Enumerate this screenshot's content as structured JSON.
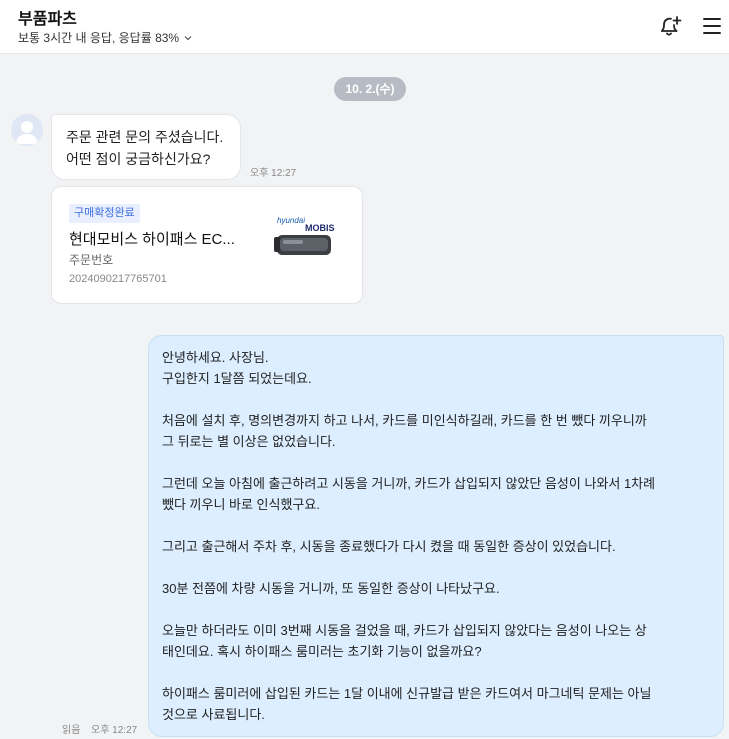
{
  "header": {
    "shop_name": "부품파츠",
    "response_info": "보통 3시간 내 응답, 응답률 83%"
  },
  "chat": {
    "date": "10. 2.(수)",
    "incoming": {
      "line1": "주문 관련 문의 주셨습니다.",
      "line2": "어떤 점이 궁금하신가요?",
      "time": "오후 12:27"
    },
    "order": {
      "status": "구매확정완료",
      "product": "현대모비스 하이패스 EC...",
      "number_label": "주문번호",
      "number": "2024090217765701",
      "thumb_brand1": "hyundai",
      "thumb_brand2": "MOBIS"
    },
    "outgoing": {
      "l1": "안녕하세요. 사장님.",
      "l2": "구입한지 1달쯤 되었는데요.",
      "l3": "처음에 설치 후, 명의변경까지 하고 나서, 카드를 미인식하길래, 카드를 한 번 뺐다 끼우니까",
      "l4": "그 뒤로는 별 이상은 없었습니다.",
      "l5": "그런데 오늘 아침에 출근하려고 시동을 거니까, 카드가 삽입되지 않았단 음성이 나와서 1차례",
      "l6": "뺐다 끼우니 바로 인식했구요.",
      "l7": "그리고 출근해서 주차 후, 시동을 종료했다가 다시 켰을 때 동일한 증상이 있었습니다.",
      "l8": "30분 전쯤에 차량 시동을 거니까, 또 동일한 증상이 나타났구요.",
      "l9": "오늘만 하더라도 이미 3번째 시동을 걸었을 때, 카드가 삽입되지 않았다는 음성이 나오는 상",
      "l10": "태인데요. 혹시 하이패스 룸미러는 초기화 기능이 없을까요?",
      "l11": "하이패스 룸미러에 삽입된 카드는 1달 이내에 신규발급 받은 카드여서 마그네틱 문제는 아닐",
      "l12": "것으로 사료됩니다.",
      "read": "읽음",
      "time": "오후 12:27"
    }
  },
  "icons": {
    "chevron": "chevron-down-icon",
    "bell": "bell-plus-icon",
    "menu": "hamburger-menu-icon",
    "avatar": "default-avatar-icon"
  }
}
